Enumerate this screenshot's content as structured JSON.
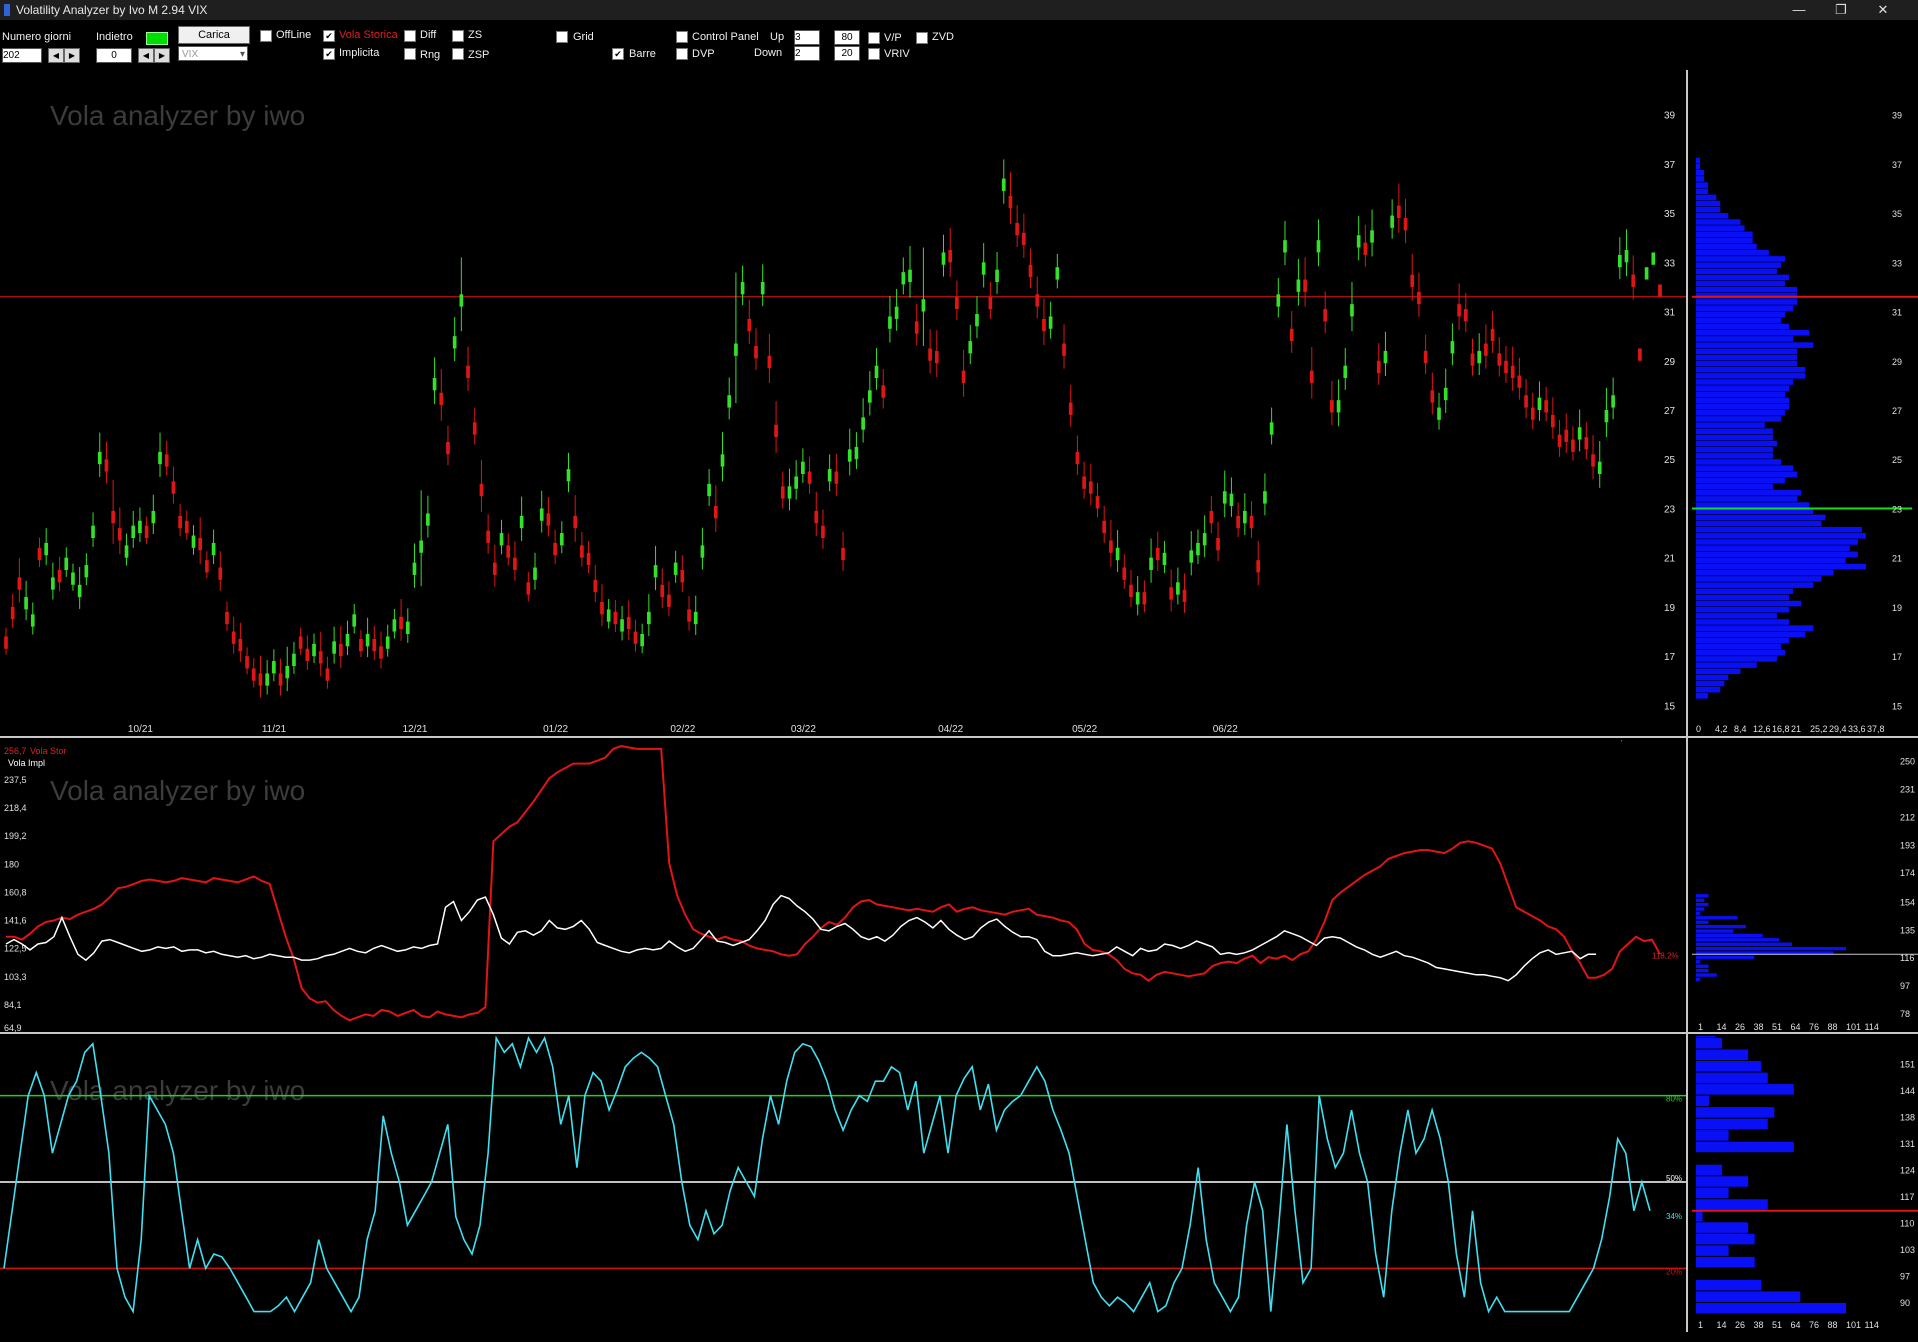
{
  "window": {
    "title": "Volatility Analyzer by Ivo M 2.94  VIX",
    "minimize": "—",
    "restore": "❐",
    "close": "✕"
  },
  "toolbar": {
    "numero_giorni_label": "Numero giorni",
    "numero_giorni_value": "202",
    "indietro_label": "Indietro",
    "indietro_value": "0",
    "carica_label": "Carica",
    "symbol_value": "VIX",
    "offline_label": "OffLine",
    "vola_storica_label": "Vola Storica",
    "implicita_label": "Implicita",
    "diff_label": "Diff",
    "rng_label": "Rng",
    "zs_label": "ZS",
    "zsp_label": "ZSP",
    "grid_label": "Grid",
    "barre_label": "Barre",
    "control_panel_label": "Control Panel",
    "dvp_label": "DVP",
    "up_label": "Up",
    "up_value": "3",
    "down_label": "Down",
    "down_value": "2",
    "val80": "80",
    "val20": "20",
    "vp_label": "V/P",
    "vriv_label": "VRIV",
    "zvd_label": "ZVD",
    "checked": {
      "offline": false,
      "vola_storica": true,
      "implicita": true,
      "diff": false,
      "rng": false,
      "zs": false,
      "zsp": false,
      "grid": false,
      "barre": true,
      "control_panel": false,
      "dvp": false,
      "vp": false,
      "vriv": false,
      "zvd": false
    },
    "status_color": "#00e000"
  },
  "watermark": "Vola analyzer by iwo",
  "colors": {
    "up": "#33e02a",
    "down": "#e01515",
    "hv": "#e01515",
    "iv": "#ffffff",
    "zs": "#40e0f0",
    "profile": "#0a10f5",
    "level80": "#1ed41e",
    "level50": "#ffffff",
    "level20": "#d01010",
    "poc": "#14e014"
  },
  "price_chart": {
    "ylim": [
      14,
      40
    ],
    "yticks": [
      "15",
      "17",
      "19",
      "21",
      "23",
      "25",
      "27",
      "29",
      "31",
      "33",
      "35",
      "37",
      "39"
    ],
    "xticks": [
      "10/21",
      "11/21",
      "12/21",
      "01/22",
      "02/22",
      "03/22",
      "04/22",
      "05/22",
      "06/22"
    ],
    "xtick_index": [
      20,
      40,
      61,
      82,
      101,
      119,
      141,
      161,
      182
    ],
    "current_level": 31.6,
    "close": [
      17.3,
      18.5,
      19.7,
      19.4,
      18.7,
      20.9,
      21.6,
      20.2,
      20.0,
      21.0,
      20.4,
      19.9,
      20.7,
      22.3,
      25.3,
      24.5,
      22.4,
      21.7,
      21.5,
      22.3,
      22.5,
      21.8,
      22.9,
      25.3,
      24.7,
      23.6,
      22.2,
      22.0,
      21.9,
      21.3,
      20.4,
      21.6,
      20.1,
      18.3,
      17.5,
      17.2,
      16.5,
      16.0,
      15.8,
      16.3,
      16.8,
      15.8,
      16.6,
      17.1,
      17.3,
      16.8,
      17.5,
      16.7,
      16.0,
      17.6,
      17.0,
      17.9,
      18.7,
      17.2,
      17.9,
      17.2,
      16.9,
      17.8,
      18.5,
      18.1,
      18.4,
      20.8,
      21.7,
      22.8,
      28.3,
      27.2,
      25.2,
      30.0,
      31.7,
      28.3,
      26.0,
      23.5,
      21.6,
      20.3,
      22.0,
      21.0,
      20.5,
      22.7,
      19.5,
      20.6,
      23.0,
      22.3,
      21.1,
      22.0,
      24.6,
      22.2,
      21.0,
      20.7,
      19.6,
      18.7,
      18.9,
      18.3,
      18.5,
      18.1,
      17.5,
      17.9,
      18.8,
      20.7,
      19.4,
      19.0,
      20.8,
      20.0,
      18.4,
      18.8,
      21.5,
      24.0,
      22.6,
      25.2,
      27.6,
      29.7,
      32.2,
      30.2,
      29.1,
      32.2,
      28.7,
      25.9,
      23.4,
      23.9,
      24.3,
      24.9,
      24.0,
      22.4,
      21.8,
      24.6,
      24.0,
      20.9,
      25.4,
      25.5,
      26.7,
      27.8,
      28.8,
      27.5,
      30.8,
      31.2,
      32.6,
      32.7,
      30.1,
      31.5,
      29.0,
      28.9,
      33.4,
      33.0,
      31.1,
      28.1,
      29.8,
      30.9,
      33.0,
      31.1,
      32.7,
      36.4,
      35.2,
      34.1,
      33.7,
      32.4,
      31.2,
      30.2,
      30.8,
      32.8,
      29.2,
      26.8,
      24.8,
      23.8,
      23.6,
      23.0,
      22.0,
      21.2,
      21.4,
      20.1,
      19.4,
      19.6,
      19.1,
      21.0,
      20.9,
      21.2,
      19.3,
      20.0,
      19.2,
      21.3,
      21.6,
      22.0,
      22.4,
      21.3,
      23.7,
      23.6,
      22.2,
      22.9,
      22.2,
      20.4,
      23.7,
      26.5,
      31.7,
      33.9,
      29.8,
      32.3,
      31.8,
      28.1,
      33.9,
      30.6,
      26.9,
      27.4,
      28.8,
      31.3,
      34.1,
      33.3,
      34.3,
      28.5,
      29.4,
      34.9,
      34.8,
      34.3,
      32.0,
      31.3,
      28.9,
      27.3,
      27.1,
      27.9,
      29.8,
      30.8,
      30.6,
      28.8,
      29.4,
      29.2,
      29.8,
      28.8,
      28.5,
      28.3,
      27.9,
      27.1,
      26.6,
      27.5,
      26.9,
      26.3,
      25.5,
      25.7,
      25.3,
      26.3,
      25.4,
      24.7,
      24.9,
      27.0,
      27.6,
      33.3,
      33.5,
      32.0,
      29.0,
      32.8,
      33.4,
      31.6
    ],
    "open": [
      17.8,
      19.0,
      20.2,
      18.9,
      18.2,
      21.4,
      21.1,
      19.7,
      20.5,
      20.5,
      19.9,
      19.4,
      20.2,
      21.8,
      24.8,
      25.0,
      22.9,
      22.2,
      21.0,
      21.8,
      22.0,
      22.3,
      22.4,
      24.8,
      25.2,
      24.1,
      22.7,
      22.5,
      21.4,
      21.8,
      20.9,
      21.1,
      20.6,
      18.8,
      18.0,
      17.7,
      17.0,
      16.5,
      16.3,
      15.8,
      16.3,
      16.3,
      16.1,
      16.6,
      17.8,
      17.3,
      17.0,
      17.2,
      16.5,
      17.1,
      17.5,
      17.4,
      18.2,
      17.7,
      17.4,
      17.7,
      17.4,
      17.3,
      18.0,
      18.6,
      17.9,
      20.3,
      21.2,
      22.3,
      27.8,
      27.7,
      25.7,
      29.5,
      31.2,
      28.8,
      26.5,
      24.0,
      22.1,
      20.8,
      21.5,
      21.5,
      21.0,
      22.2,
      20.0,
      20.1,
      22.5,
      22.8,
      21.6,
      21.5,
      24.1,
      22.7,
      21.5,
      21.2,
      20.1,
      19.2,
      18.4,
      18.8,
      18.0,
      18.6,
      18.0,
      17.4,
      18.3,
      20.2,
      19.9,
      19.5,
      20.3,
      20.5,
      18.9,
      18.3,
      21.0,
      23.5,
      23.1,
      24.7,
      27.1,
      29.2,
      31.7,
      30.7,
      29.6,
      31.7,
      29.2,
      26.4,
      23.9,
      23.4,
      23.8,
      24.4,
      24.5,
      22.9,
      22.3,
      24.1,
      24.5,
      21.4,
      24.9,
      25.0,
      26.2,
      27.3,
      28.3,
      28.0,
      30.3,
      30.7,
      32.1,
      32.2,
      30.6,
      31.0,
      29.5,
      29.4,
      32.9,
      33.5,
      31.6,
      28.6,
      29.3,
      30.4,
      32.5,
      31.6,
      32.2,
      35.9,
      35.7,
      34.6,
      34.2,
      32.9,
      31.7,
      30.7,
      30.3,
      32.3,
      29.7,
      27.3,
      25.3,
      24.3,
      24.1,
      23.5,
      22.5,
      21.7,
      20.9,
      20.6,
      19.9,
      19.1,
      19.6,
      20.5,
      21.4,
      20.7,
      19.8,
      19.5,
      19.7,
      20.8,
      21.1,
      21.5,
      22.9,
      21.8,
      23.2,
      23.1,
      22.7,
      22.4,
      22.7,
      20.9,
      23.2,
      26.0,
      31.2,
      33.4,
      30.3,
      31.8,
      32.3,
      28.6,
      33.4,
      31.1,
      27.4,
      26.9,
      28.3,
      30.8,
      33.6,
      33.8,
      33.8,
      29.0,
      28.9,
      34.4,
      35.3,
      34.8,
      32.5,
      31.8,
      29.4,
      27.8,
      26.6,
      27.4,
      29.3,
      31.3,
      31.1,
      29.3,
      28.9,
      29.7,
      30.3,
      29.3,
      29.0,
      28.8,
      28.4,
      27.6,
      27.1,
      27.0,
      27.4,
      26.8,
      26.0,
      26.2,
      25.8,
      25.8,
      25.9,
      25.2,
      24.4,
      26.5,
      27.1,
      32.8,
      33.0,
      32.5,
      29.5,
      32.3,
      32.9,
      32.1
    ],
    "range": [
      0.6,
      0.9,
      1.3,
      1.1,
      0.8,
      0.7,
      1.0,
      1.0,
      0.9,
      0.7,
      0.6,
      1.2,
      0.8,
      0.9,
      1.3,
      1.2,
      2.1,
      1.4,
      0.8,
      1.0,
      0.9,
      0.6,
      1.1,
      1.3,
      0.9,
      1.0,
      0.8,
      0.7,
      0.7,
      1.4,
      0.6,
      0.9,
      1.1,
      0.7,
      1.0,
      1.1,
      0.6,
      0.7,
      1.2,
      0.9,
      0.8,
      1.0,
      1.3,
      0.8,
      0.6,
      0.9,
      0.7,
      1.3,
      0.8,
      1.0,
      1.2,
      0.9,
      0.7,
      0.6,
      1.1,
      0.9,
      1.0,
      0.8,
      0.7,
      1.2,
      0.9,
      1.3,
      3.4,
      1.2,
      1.4,
      1.6,
      1.1,
      1.3,
      2.5,
      1.3,
      1.0,
      1.6,
      1.1,
      1.2,
      0.9,
      0.8,
      1.1,
      1.3,
      0.7,
      1.0,
      1.2,
      1.1,
      0.9,
      0.8,
      1.1,
      1.4,
      0.9,
      0.8,
      1.0,
      1.2,
      0.7,
      0.8,
      0.9,
      1.1,
      0.8,
      0.7,
      1.2,
      1.3,
      1.1,
      0.9,
      0.8,
      1.0,
      0.9,
      1.1,
      1.2,
      1.0,
      1.4,
      1.5,
      1.2,
      4.8,
      1.1,
      1.3,
      1.2,
      1.2,
      1.5,
      1.6,
      1.0,
      1.2,
      1.1,
      0.9,
      1.0,
      1.3,
      1.1,
      1.0,
      1.2,
      1.1,
      1.4,
      1.0,
      1.3,
      1.3,
      1.2,
      1.1,
      1.4,
      1.2,
      1.0,
      1.6,
      1.2,
      3.5,
      1.3,
      1.4,
      1.2,
      1.5,
      1.1,
      1.4,
      1.1,
      1.2,
      1.3,
      1.0,
      1.2,
      1.3,
      1.6,
      1.2,
      1.3,
      1.1,
      1.2,
      1.4,
      1.0,
      0.9,
      1.3,
      1.2,
      1.1,
      1.0,
      1.2,
      0.9,
      1.0,
      1.4,
      1.2,
      0.9,
      1.0,
      1.1,
      0.8,
      1.3,
      1.1,
      0.8,
      1.2,
      1.0,
      1.1,
      1.3,
      0.9,
      1.2,
      1.0,
      1.1,
      1.4,
      1.1,
      0.9,
      1.2,
      1.0,
      1.3,
      1.2,
      1.0,
      1.1,
      1.3,
      1.2,
      1.4,
      1.5,
      1.6,
      1.4,
      1.2,
      1.3,
      1.4,
      1.2,
      1.5,
      1.3,
      1.2,
      1.4,
      1.2,
      1.3,
      1.1,
      1.5,
      1.3,
      1.4,
      1.3,
      1.1,
      1.2,
      1.0,
      1.3,
      1.2,
      1.4,
      1.1,
      1.0,
      1.2,
      1.3,
      1.2,
      1.1,
      1.0,
      1.3,
      1.2,
      1.1,
      1.0,
      1.1,
      0.9,
      1.2,
      1.0,
      1.1,
      0.9,
      1.2,
      1.0,
      1.3,
      1.4,
      1.5,
      1.2,
      1.2,
      1.4,
      1.3
    ]
  },
  "volume_profile": {
    "xticks": [
      "0",
      "4,2",
      "8,4",
      "12,6",
      "16,8",
      "21",
      "25,2",
      "29,4",
      "33,6",
      "37,8"
    ],
    "yticks": [
      "15",
      "17",
      "19",
      "21",
      "23",
      "25",
      "27",
      "29",
      "31",
      "33",
      "35",
      "37",
      "39"
    ],
    "poc_level": 23.0
  },
  "vol_chart": {
    "label_hv": "Vola Stor",
    "label_iv": "Vola Impl",
    "hv_last_label": "256,7",
    "yticks": [
      "84,1",
      "103,3",
      "122,5",
      "141,6",
      "160,8",
      "180",
      "199,2",
      "218,4",
      "237,5"
    ],
    "yticks_bottom": "64,9",
    "iv_last_label": "110,1%",
    "hv_last_pct": "118,2%",
    "ylim": [
      65,
      260
    ],
    "hv": [
      130,
      130,
      128,
      132,
      137,
      140,
      141,
      143,
      142,
      145,
      147,
      149,
      152,
      157,
      163,
      164,
      166,
      168,
      169,
      168,
      167,
      168,
      170,
      169,
      168,
      167,
      170,
      169,
      168,
      167,
      169,
      171,
      168,
      166,
      148,
      130,
      115,
      95,
      88,
      85,
      86,
      80,
      76,
      73,
      75,
      77,
      76,
      80,
      79,
      76,
      78,
      80,
      76,
      75,
      79,
      77,
      76,
      75,
      77,
      78,
      82,
      195,
      200,
      205,
      208,
      215,
      222,
      230,
      238,
      242,
      245,
      248,
      248,
      248,
      250,
      252,
      258,
      260,
      259,
      258,
      258,
      258,
      258,
      180,
      158,
      145,
      135,
      132,
      130,
      128,
      130,
      128,
      127,
      124,
      122,
      121,
      120,
      118,
      117,
      118,
      125,
      130,
      136,
      140,
      138,
      143,
      150,
      154,
      155,
      152,
      151,
      150,
      149,
      148,
      149,
      148,
      147,
      150,
      152,
      147,
      149,
      150,
      148,
      147,
      146,
      145,
      147,
      148,
      149,
      145,
      144,
      143,
      141,
      140,
      135,
      125,
      121,
      120,
      118,
      114,
      108,
      105,
      104,
      100,
      104,
      106,
      105,
      104,
      103,
      104,
      105,
      110,
      112,
      113,
      112,
      115,
      117,
      112,
      116,
      115,
      117,
      114,
      118,
      120,
      128,
      140,
      155,
      160,
      164,
      168,
      172,
      175,
      178,
      183,
      185,
      187,
      188,
      189,
      189,
      188,
      187,
      190,
      194,
      195,
      194,
      192,
      190,
      180,
      165,
      150,
      147,
      144,
      141,
      137,
      135,
      130,
      120,
      112,
      102,
      102,
      104,
      108,
      120,
      125,
      130,
      127,
      128,
      118
    ],
    "iv": [
      125,
      128,
      125,
      121,
      125,
      126,
      130,
      143,
      130,
      118,
      114,
      119,
      127,
      128,
      126,
      124,
      122,
      120,
      121,
      123,
      122,
      123,
      120,
      121,
      121,
      119,
      120,
      118,
      117,
      116,
      117,
      115,
      116,
      118,
      117,
      116,
      116,
      114,
      114,
      115,
      117,
      118,
      120,
      122,
      120,
      119,
      122,
      124,
      122,
      120,
      121,
      123,
      122,
      124,
      125,
      150,
      154,
      141,
      147,
      155,
      157,
      145,
      129,
      125,
      133,
      134,
      131,
      134,
      141,
      136,
      135,
      137,
      141,
      135,
      126,
      124,
      122,
      120,
      119,
      121,
      122,
      121,
      122,
      127,
      123,
      120,
      122,
      128,
      134,
      127,
      126,
      124,
      126,
      128,
      134,
      141,
      152,
      158,
      156,
      151,
      147,
      142,
      135,
      134,
      137,
      139,
      135,
      130,
      128,
      130,
      127,
      131,
      137,
      141,
      143,
      140,
      136,
      141,
      135,
      131,
      128,
      130,
      136,
      140,
      142,
      137,
      133,
      130,
      130,
      128,
      120,
      117,
      117,
      118,
      119,
      118,
      117,
      118,
      119,
      123,
      120,
      117,
      122,
      120,
      121,
      125,
      124,
      122,
      124,
      127,
      125,
      123,
      118,
      119,
      118,
      119,
      121,
      124,
      127,
      130,
      134,
      132,
      130,
      127,
      124,
      129,
      130,
      129,
      126,
      123,
      121,
      118,
      116,
      118,
      120,
      117,
      116,
      114,
      112,
      109,
      108,
      107,
      106,
      105,
      104,
      104,
      103,
      102,
      100,
      104,
      110,
      115,
      119,
      121,
      118,
      119,
      120,
      115,
      118,
      118
    ],
    "profile_xticks": [
      "1",
      "14",
      "26",
      "38",
      "51",
      "64",
      "76",
      "88",
      "101",
      "114"
    ],
    "profile_yticks": [
      "78",
      "97",
      "116",
      "135",
      "154",
      "174",
      "193",
      "212",
      "231",
      "250"
    ]
  },
  "zs_chart": {
    "level80_label": "80%",
    "level50_label": "50%",
    "level20_label": "20%",
    "current_label": "34%",
    "values": [
      20,
      40,
      60,
      80,
      88,
      80,
      60,
      70,
      80,
      85,
      95,
      98,
      80,
      60,
      20,
      10,
      5,
      30,
      80,
      75,
      70,
      60,
      40,
      20,
      30,
      20,
      25,
      24,
      20,
      15,
      10,
      5,
      5,
      5,
      7,
      10,
      5,
      10,
      15,
      30,
      20,
      15,
      10,
      5,
      10,
      30,
      40,
      73,
      60,
      50,
      35,
      40,
      45,
      50,
      60,
      70,
      38,
      30,
      25,
      35,
      60,
      100,
      95,
      98,
      90,
      100,
      95,
      100,
      90,
      70,
      80,
      55,
      80,
      88,
      85,
      75,
      82,
      90,
      93,
      95,
      93,
      90,
      80,
      70,
      50,
      35,
      30,
      40,
      32,
      35,
      47,
      55,
      50,
      45,
      65,
      80,
      70,
      85,
      95,
      98,
      97,
      92,
      85,
      75,
      68,
      75,
      80,
      78,
      85,
      85,
      90,
      88,
      75,
      85,
      60,
      70,
      80,
      60,
      80,
      86,
      90,
      75,
      84,
      68,
      75,
      78,
      80,
      85,
      90,
      85,
      75,
      68,
      60,
      45,
      30,
      15,
      10,
      7,
      10,
      8,
      5,
      10,
      15,
      5,
      7,
      15,
      20,
      35,
      55,
      30,
      15,
      10,
      5,
      10,
      35,
      50,
      40,
      5,
      35,
      70,
      40,
      15,
      20,
      80,
      65,
      55,
      60,
      75,
      60,
      50,
      25,
      10,
      40,
      60,
      75,
      60,
      65,
      75,
      65,
      50,
      25,
      10,
      40,
      15,
      5,
      10,
      5,
      5,
      5,
      5,
      5,
      5,
      5,
      5,
      5,
      10,
      15,
      20,
      30,
      45,
      65,
      60,
      40,
      50,
      40
    ],
    "profile_xticks": [
      "1",
      "14",
      "26",
      "38",
      "51",
      "64",
      "76",
      "88",
      "101",
      "114"
    ],
    "profile_yticks": [
      "90",
      "97",
      "103",
      "110",
      "117",
      "124",
      "131",
      "138",
      "144",
      "151"
    ]
  }
}
